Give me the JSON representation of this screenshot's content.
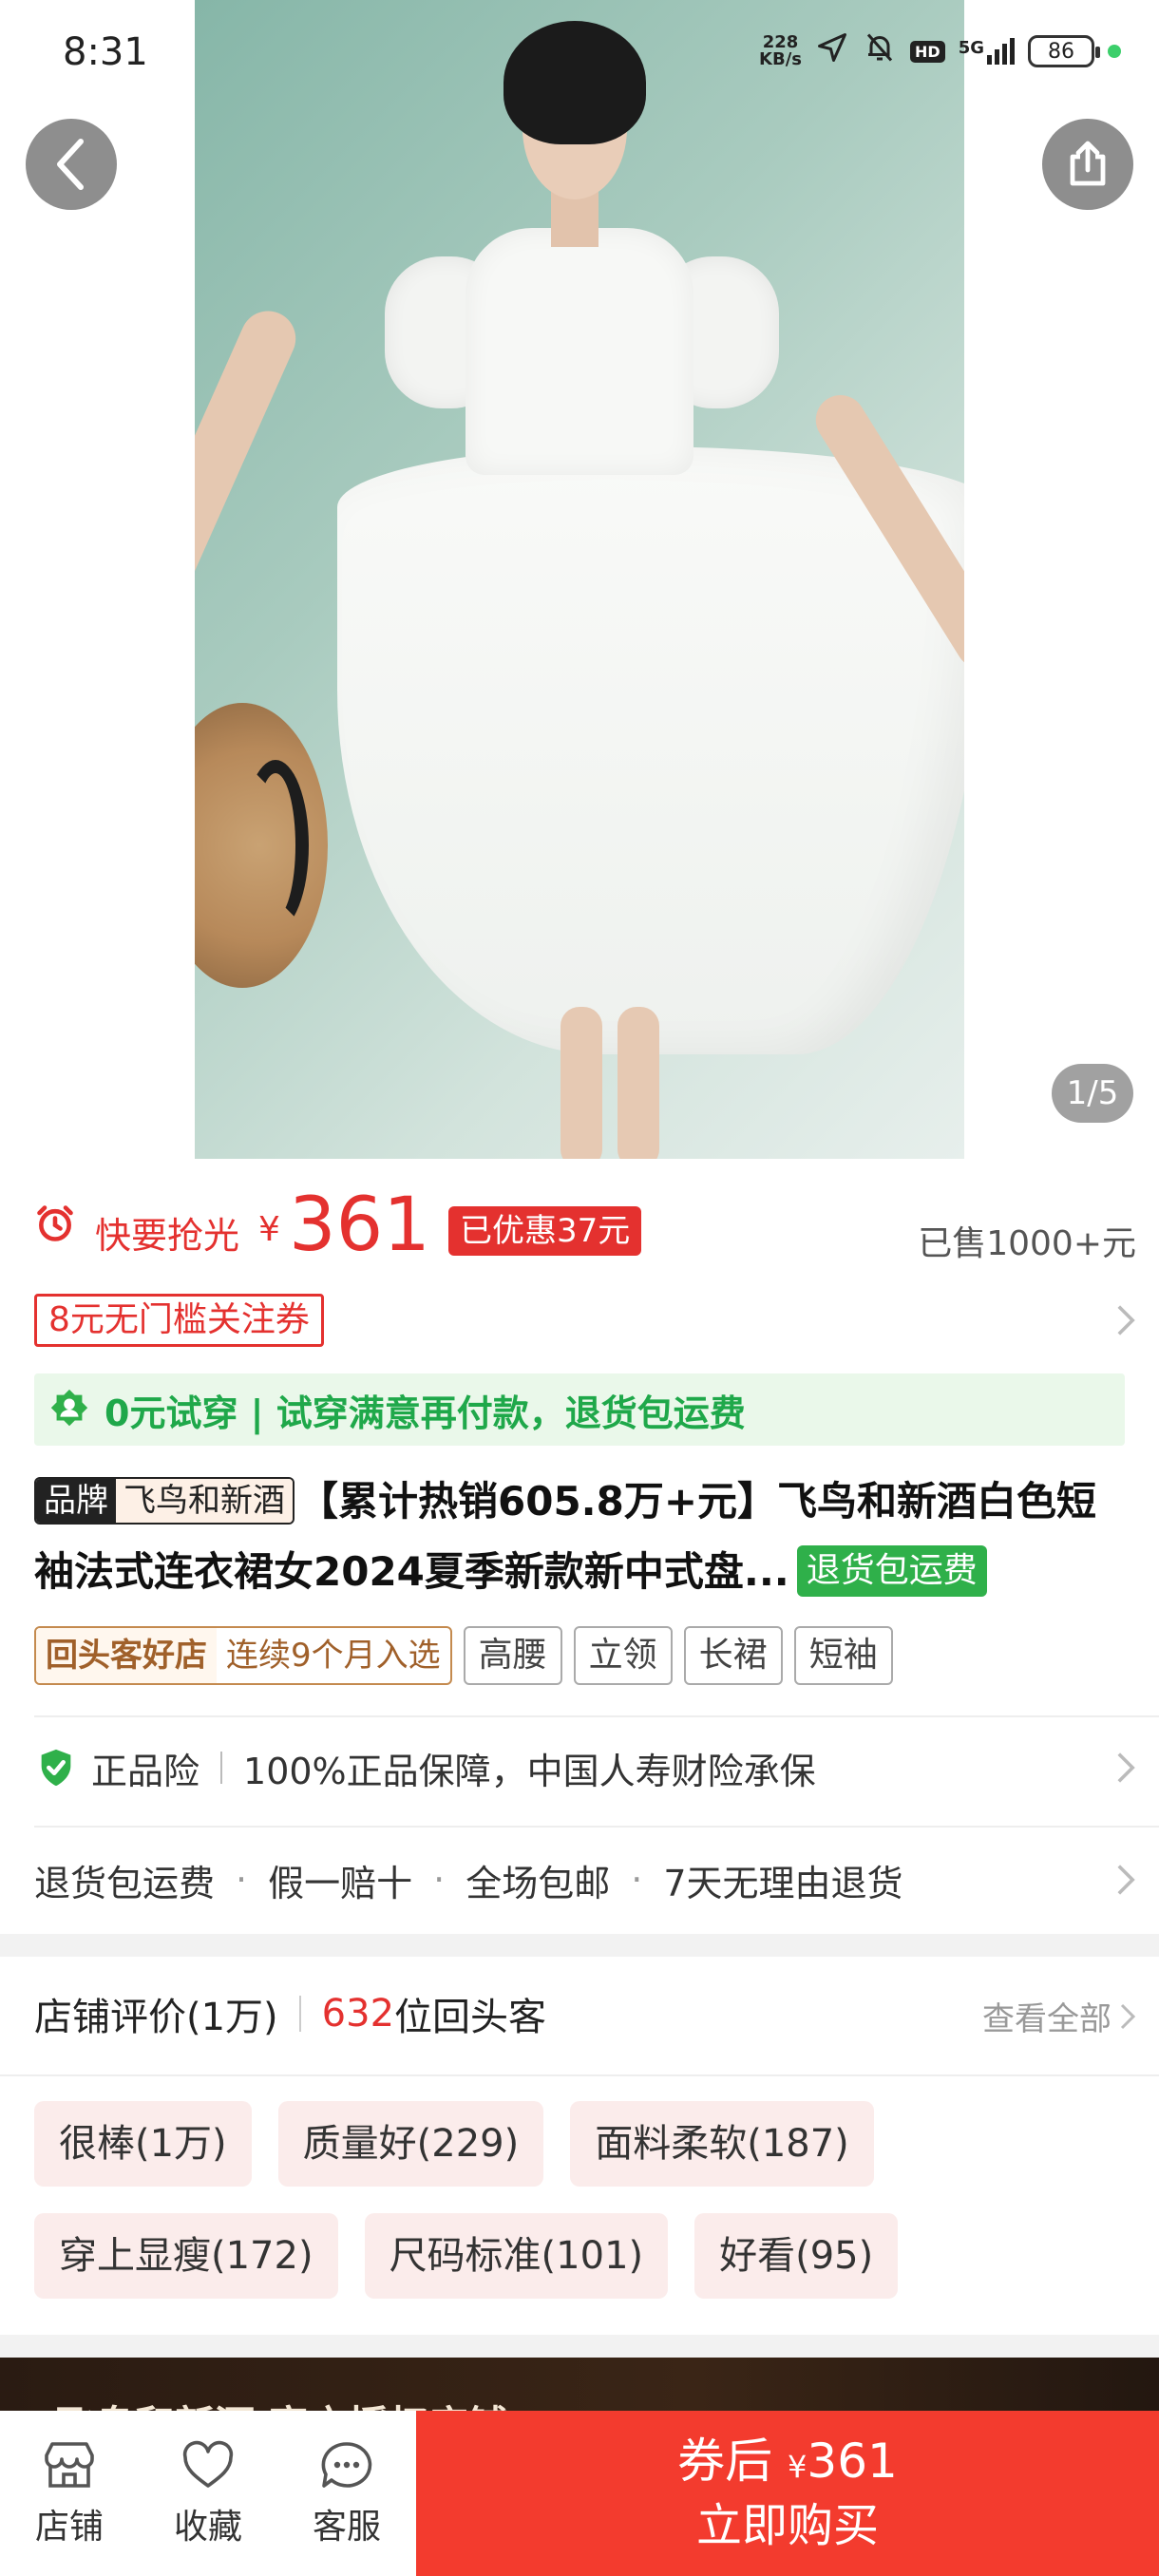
{
  "status_bar": {
    "time": "8:31",
    "net_speed_value": "228",
    "net_speed_unit": "KB/s",
    "network": "5G",
    "battery": "86",
    "hd": "HD"
  },
  "gallery": {
    "counter": "1/5"
  },
  "price": {
    "rush_label": "快要抢光",
    "currency": "¥",
    "amount": "361",
    "tag": "已优惠37元",
    "sold": "已售1000+元"
  },
  "coupon": {
    "label": "8元无门槛关注券"
  },
  "tryon": {
    "text": "0元试穿 | 试穿满意再付款，退货包运费"
  },
  "product": {
    "brand_label": "品牌",
    "brand_name": "飞鸟和新酒",
    "title": "【累计热销605.8万+元】飞鸟和新酒白色短袖法式连衣裙女2024夏季新款新中式盘...",
    "return_badge": "退货包运费"
  },
  "tags": {
    "rebuy_label": "回头客好店",
    "rebuy_value": "连续9个月入选",
    "items": [
      "高腰",
      "立领",
      "长裙",
      "短袖"
    ]
  },
  "guarantee": {
    "label": "正品险",
    "text": "100%正品保障，中国人寿财险承保"
  },
  "services": [
    "退货包运费",
    "假一赔十",
    "全场包邮",
    "7天无理由退货"
  ],
  "reviews": {
    "title": "店铺评价(1万)",
    "repeat_count": "632",
    "repeat_suffix": "位回头客",
    "see_all": "查看全部",
    "tags": [
      "很棒(1万)",
      "质量好(229)",
      "面料柔软(187)",
      "穿上显瘦(172)",
      "尺码标准(101)",
      "好看(95)"
    ]
  },
  "store_banner": {
    "name": "飞鸟和新酒 官方授权店铺"
  },
  "bottom_nav": {
    "store": "店铺",
    "favorite": "收藏",
    "service": "客服"
  },
  "buy_button": {
    "prefix": "券后",
    "currency": "¥",
    "amount": "361",
    "action": "立即购买"
  },
  "colors": {
    "accent_red": "#e4312f",
    "buy_red": "#f33b2e",
    "green": "#1fa84a",
    "review_tag_bg": "#fbeceb"
  }
}
